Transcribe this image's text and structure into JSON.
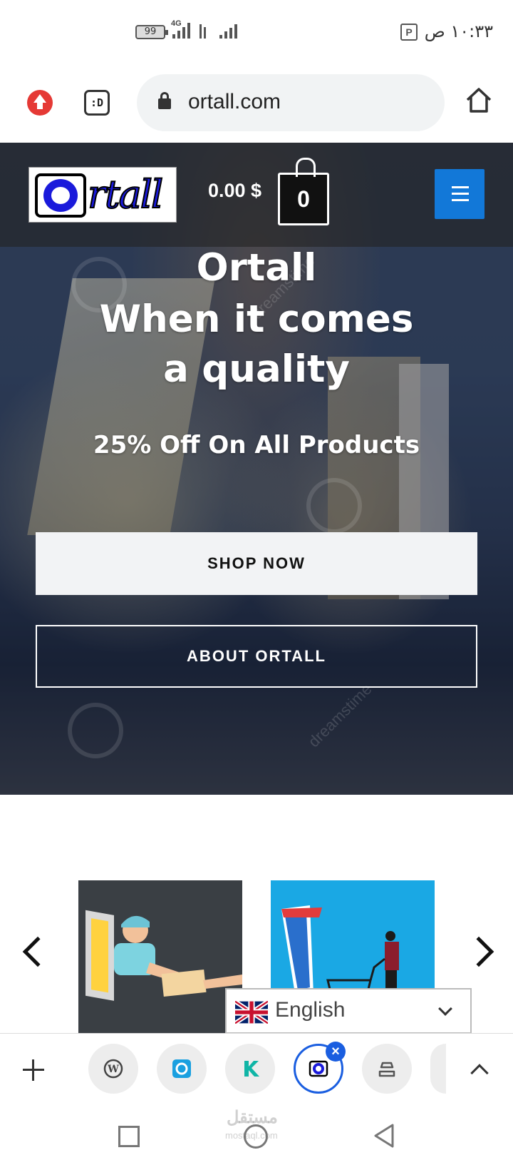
{
  "status_bar": {
    "battery": "99",
    "network": "4G",
    "time": "١٠:٣٣ ص",
    "doc_icon": "P"
  },
  "browser": {
    "url": "ortall.com",
    "tab_count": ":D"
  },
  "header": {
    "logo_text": "rtall",
    "cart_total": "0.00 $",
    "cart_count": "0",
    "menu_color": "#1278d8"
  },
  "hero": {
    "title_line1": "Ortall",
    "title_line2": "When it comes a quality",
    "offer": "25% Off On All Products",
    "shop_button": "SHOP NOW",
    "about_button": "ABOUT ORTALL",
    "watermark": "dreamstime"
  },
  "language": {
    "selected": "English"
  },
  "tabs": {
    "favicons": [
      "wordpress-icon",
      "camera-icon",
      "k-app-icon",
      "ortall-icon",
      "stack-icon"
    ],
    "active_index": 3
  },
  "system_nav": {
    "watermark": "مستقل",
    "watermark_sub": "mostaql.com"
  }
}
